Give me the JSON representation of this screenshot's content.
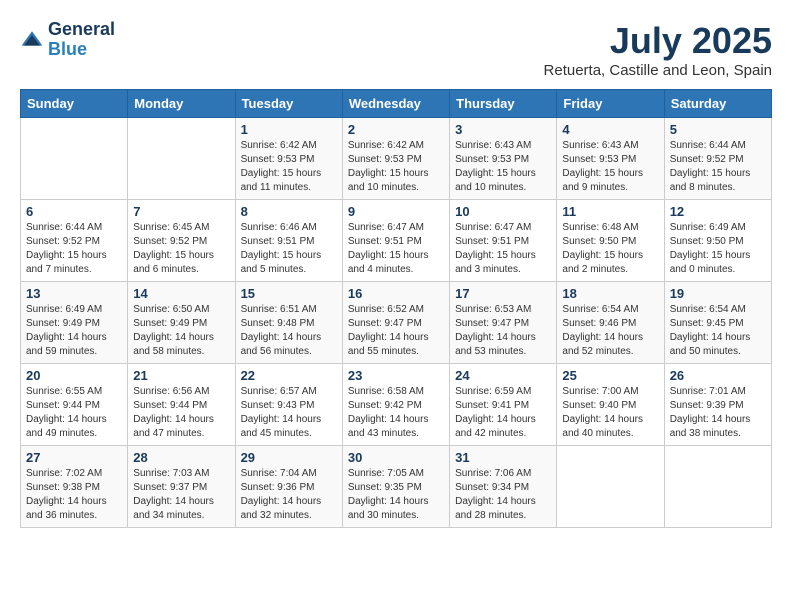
{
  "header": {
    "logo_line1": "General",
    "logo_line2": "Blue",
    "month": "July 2025",
    "location": "Retuerta, Castille and Leon, Spain"
  },
  "weekdays": [
    "Sunday",
    "Monday",
    "Tuesday",
    "Wednesday",
    "Thursday",
    "Friday",
    "Saturday"
  ],
  "weeks": [
    [
      {
        "day": "",
        "info": ""
      },
      {
        "day": "",
        "info": ""
      },
      {
        "day": "1",
        "info": "Sunrise: 6:42 AM\nSunset: 9:53 PM\nDaylight: 15 hours and 11 minutes."
      },
      {
        "day": "2",
        "info": "Sunrise: 6:42 AM\nSunset: 9:53 PM\nDaylight: 15 hours and 10 minutes."
      },
      {
        "day": "3",
        "info": "Sunrise: 6:43 AM\nSunset: 9:53 PM\nDaylight: 15 hours and 10 minutes."
      },
      {
        "day": "4",
        "info": "Sunrise: 6:43 AM\nSunset: 9:53 PM\nDaylight: 15 hours and 9 minutes."
      },
      {
        "day": "5",
        "info": "Sunrise: 6:44 AM\nSunset: 9:52 PM\nDaylight: 15 hours and 8 minutes."
      }
    ],
    [
      {
        "day": "6",
        "info": "Sunrise: 6:44 AM\nSunset: 9:52 PM\nDaylight: 15 hours and 7 minutes."
      },
      {
        "day": "7",
        "info": "Sunrise: 6:45 AM\nSunset: 9:52 PM\nDaylight: 15 hours and 6 minutes."
      },
      {
        "day": "8",
        "info": "Sunrise: 6:46 AM\nSunset: 9:51 PM\nDaylight: 15 hours and 5 minutes."
      },
      {
        "day": "9",
        "info": "Sunrise: 6:47 AM\nSunset: 9:51 PM\nDaylight: 15 hours and 4 minutes."
      },
      {
        "day": "10",
        "info": "Sunrise: 6:47 AM\nSunset: 9:51 PM\nDaylight: 15 hours and 3 minutes."
      },
      {
        "day": "11",
        "info": "Sunrise: 6:48 AM\nSunset: 9:50 PM\nDaylight: 15 hours and 2 minutes."
      },
      {
        "day": "12",
        "info": "Sunrise: 6:49 AM\nSunset: 9:50 PM\nDaylight: 15 hours and 0 minutes."
      }
    ],
    [
      {
        "day": "13",
        "info": "Sunrise: 6:49 AM\nSunset: 9:49 PM\nDaylight: 14 hours and 59 minutes."
      },
      {
        "day": "14",
        "info": "Sunrise: 6:50 AM\nSunset: 9:49 PM\nDaylight: 14 hours and 58 minutes."
      },
      {
        "day": "15",
        "info": "Sunrise: 6:51 AM\nSunset: 9:48 PM\nDaylight: 14 hours and 56 minutes."
      },
      {
        "day": "16",
        "info": "Sunrise: 6:52 AM\nSunset: 9:47 PM\nDaylight: 14 hours and 55 minutes."
      },
      {
        "day": "17",
        "info": "Sunrise: 6:53 AM\nSunset: 9:47 PM\nDaylight: 14 hours and 53 minutes."
      },
      {
        "day": "18",
        "info": "Sunrise: 6:54 AM\nSunset: 9:46 PM\nDaylight: 14 hours and 52 minutes."
      },
      {
        "day": "19",
        "info": "Sunrise: 6:54 AM\nSunset: 9:45 PM\nDaylight: 14 hours and 50 minutes."
      }
    ],
    [
      {
        "day": "20",
        "info": "Sunrise: 6:55 AM\nSunset: 9:44 PM\nDaylight: 14 hours and 49 minutes."
      },
      {
        "day": "21",
        "info": "Sunrise: 6:56 AM\nSunset: 9:44 PM\nDaylight: 14 hours and 47 minutes."
      },
      {
        "day": "22",
        "info": "Sunrise: 6:57 AM\nSunset: 9:43 PM\nDaylight: 14 hours and 45 minutes."
      },
      {
        "day": "23",
        "info": "Sunrise: 6:58 AM\nSunset: 9:42 PM\nDaylight: 14 hours and 43 minutes."
      },
      {
        "day": "24",
        "info": "Sunrise: 6:59 AM\nSunset: 9:41 PM\nDaylight: 14 hours and 42 minutes."
      },
      {
        "day": "25",
        "info": "Sunrise: 7:00 AM\nSunset: 9:40 PM\nDaylight: 14 hours and 40 minutes."
      },
      {
        "day": "26",
        "info": "Sunrise: 7:01 AM\nSunset: 9:39 PM\nDaylight: 14 hours and 38 minutes."
      }
    ],
    [
      {
        "day": "27",
        "info": "Sunrise: 7:02 AM\nSunset: 9:38 PM\nDaylight: 14 hours and 36 minutes."
      },
      {
        "day": "28",
        "info": "Sunrise: 7:03 AM\nSunset: 9:37 PM\nDaylight: 14 hours and 34 minutes."
      },
      {
        "day": "29",
        "info": "Sunrise: 7:04 AM\nSunset: 9:36 PM\nDaylight: 14 hours and 32 minutes."
      },
      {
        "day": "30",
        "info": "Sunrise: 7:05 AM\nSunset: 9:35 PM\nDaylight: 14 hours and 30 minutes."
      },
      {
        "day": "31",
        "info": "Sunrise: 7:06 AM\nSunset: 9:34 PM\nDaylight: 14 hours and 28 minutes."
      },
      {
        "day": "",
        "info": ""
      },
      {
        "day": "",
        "info": ""
      }
    ]
  ]
}
